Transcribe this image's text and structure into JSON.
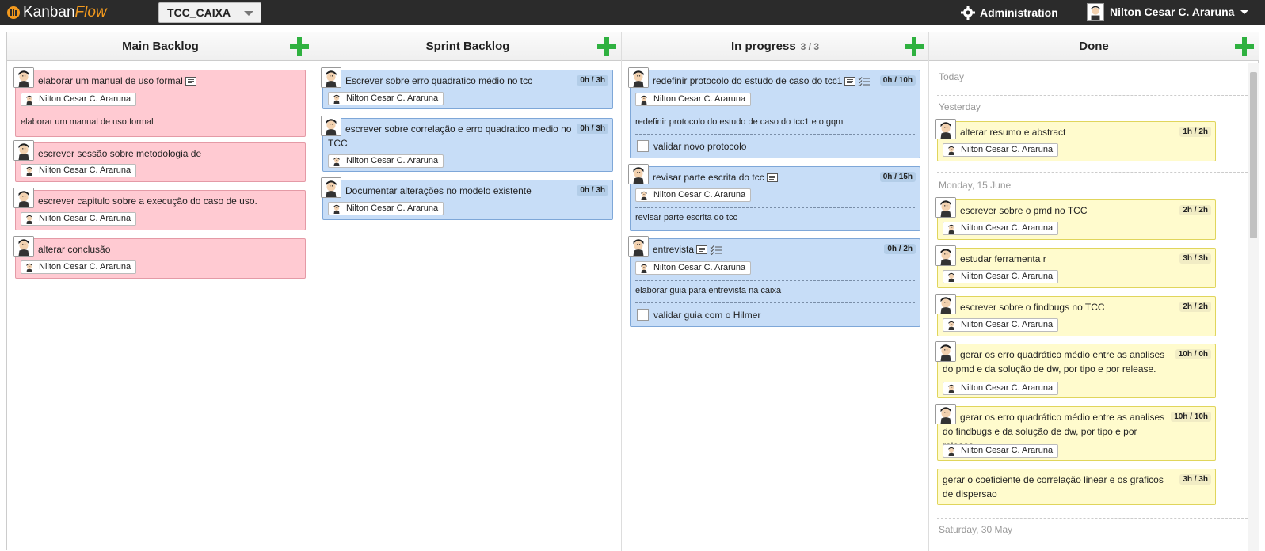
{
  "app": {
    "logo_kanban": "Kanban",
    "logo_flow": "Flow",
    "board_name": "TCC_CAIXA",
    "admin_label": "Administration",
    "user_name": "Nilton Cesar C. Araruna"
  },
  "columns": [
    {
      "title": "Main Backlog",
      "count": ""
    },
    {
      "title": "Sprint Backlog",
      "count": ""
    },
    {
      "title": "In progress",
      "count": "3 / 3"
    },
    {
      "title": "Done",
      "count": ""
    }
  ],
  "main_backlog": [
    {
      "title": "elaborar um manual de uso formal",
      "assignee": "Nilton Cesar C. Araruna",
      "desc": "elaborar um manual de uso formal"
    },
    {
      "title": "escrever sessão sobre metodologia de desenvolvimento",
      "assignee": "Nilton Cesar C. Araruna"
    },
    {
      "title": "escrever capitulo sobre a execução do caso de uso.",
      "assignee": "Nilton Cesar C. Araruna"
    },
    {
      "title": "alterar conclusão",
      "assignee": "Nilton Cesar C. Araruna"
    }
  ],
  "sprint_backlog": [
    {
      "title": "Escrever sobre erro quadratico médio no tcc",
      "time": "0h / 3h",
      "assignee": "Nilton Cesar C. Araruna"
    },
    {
      "title": "escrever sobre correlação e erro quadratico medio no TCC",
      "time": "0h / 3h",
      "assignee": "Nilton Cesar C. Araruna"
    },
    {
      "title": "Documentar alterações no modelo existente",
      "time": "0h / 3h",
      "assignee": "Nilton Cesar C. Araruna"
    }
  ],
  "in_progress": [
    {
      "title": "redefinir protocolo do estudo de caso do tcc1",
      "time": "0h / 10h",
      "assignee": "Nilton Cesar C. Araruna",
      "desc": "redefinir protocolo do estudo de caso do tcc1 e o gqm",
      "subtask": "validar novo protocolo"
    },
    {
      "title": "revisar parte escrita do tcc",
      "time": "0h / 15h",
      "assignee": "Nilton Cesar C. Araruna",
      "desc": "revisar parte escrita do tcc"
    },
    {
      "title": "entrevista",
      "time": "0h / 2h",
      "assignee": "Nilton Cesar C. Araruna",
      "desc": "elaborar guia para entrevista na caixa",
      "subtask": "validar guia com o Hilmer"
    }
  ],
  "done": {
    "groups": [
      "Today",
      "Yesterday",
      "Monday, 15 June",
      "Saturday, 30 May"
    ],
    "tasks": [
      {
        "title": "alterar resumo e abstract",
        "time": "1h / 2h",
        "assignee": "Nilton Cesar C. Araruna"
      },
      {
        "title": "escrever sobre o pmd no TCC",
        "time": "2h / 2h",
        "assignee": "Nilton Cesar C. Araruna"
      },
      {
        "title": "estudar ferramenta r",
        "time": "3h / 3h",
        "assignee": "Nilton Cesar C. Araruna"
      },
      {
        "title": "escrever sobre o findbugs no TCC",
        "time": "2h / 2h",
        "assignee": "Nilton Cesar C. Araruna"
      },
      {
        "title": "gerar os erro quadrático médio entre as analises do pmd e da solução de dw, por tipo e por release.",
        "time": "10h / 0h",
        "assignee": "Nilton Cesar C. Araruna"
      },
      {
        "title": "gerar os erro quadrático médio entre as analises do findbugs e da solução de dw, por tipo e por release.",
        "time": "10h / 10h",
        "assignee": "Nilton Cesar C. Araruna"
      },
      {
        "title": "gerar o coeficiente de correlação linear e os graficos de dispersao",
        "time": "3h / 3h"
      }
    ]
  },
  "colors": {
    "backlog_card": "#ffcad2",
    "sprint_card": "#c7ddf7",
    "done_card": "#fffbcd",
    "add_button": "#2fb140",
    "logo_accent": "#f39a1e"
  },
  "icons": [
    "logo-icon",
    "gear-icon",
    "avatar",
    "add-icon",
    "description-icon",
    "subtasks-icon",
    "chevron-down-icon"
  ]
}
